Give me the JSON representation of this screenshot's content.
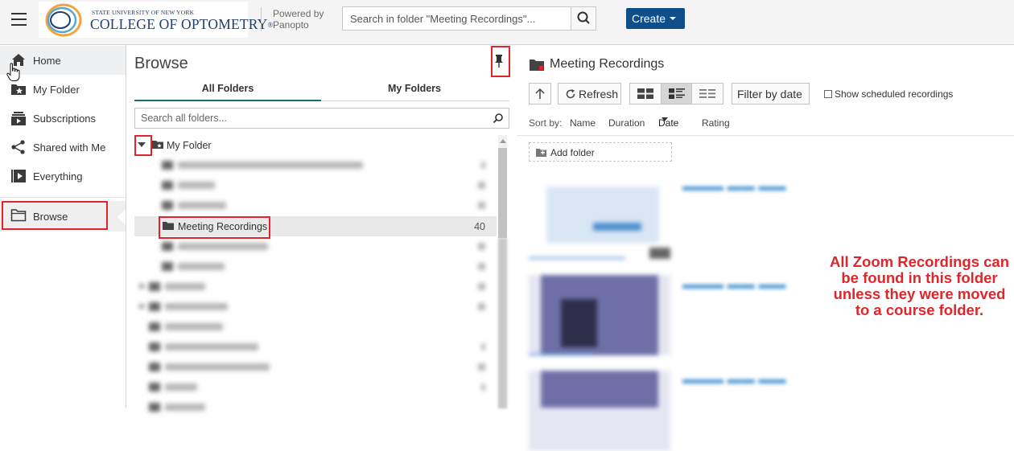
{
  "header": {
    "logo_small": "STATE UNIVERSITY OF NEW YORK",
    "logo_big": "COLLEGE OF OPTOMETRY",
    "logo_mark": "®",
    "powered_line1": "Powered by",
    "powered_line2": "Panopto",
    "search_placeholder": "Search in folder \"Meeting Recordings\"...",
    "create_label": "Create",
    "brand_color": "#0e4f8b"
  },
  "sidebar": {
    "items": [
      {
        "label": "Home",
        "icon": "home-icon"
      },
      {
        "label": "My Folder",
        "icon": "star-folder-icon"
      },
      {
        "label": "Subscriptions",
        "icon": "subscriptions-icon"
      },
      {
        "label": "Shared with Me",
        "icon": "share-icon"
      },
      {
        "label": "Everything",
        "icon": "play-stack-icon"
      },
      {
        "label": "Browse",
        "icon": "folder-outline-icon"
      }
    ]
  },
  "browse": {
    "title": "Browse",
    "tabs": [
      "All Folders",
      "My Folders"
    ],
    "active_tab": "All Folders",
    "search_placeholder": "Search all folders...",
    "my_folder_label": "My Folder",
    "selected_folder": {
      "label": "Meeting Recordings",
      "count": "40"
    }
  },
  "main": {
    "folder_title": "Meeting Recordings",
    "refresh_label": "Refresh",
    "filter_label": "Filter by date",
    "show_scheduled_label": "Show scheduled recordings",
    "sort_by_label": "Sort by:",
    "sort_options": [
      "Name",
      "Duration",
      "Date",
      "Rating"
    ],
    "active_sort": "Date",
    "add_folder_label": "Add folder"
  },
  "annotation": {
    "callout_text": "All Zoom Recordings can be found in this folder unless they were moved to a course folder.",
    "highlight_color": "#e0262b"
  }
}
